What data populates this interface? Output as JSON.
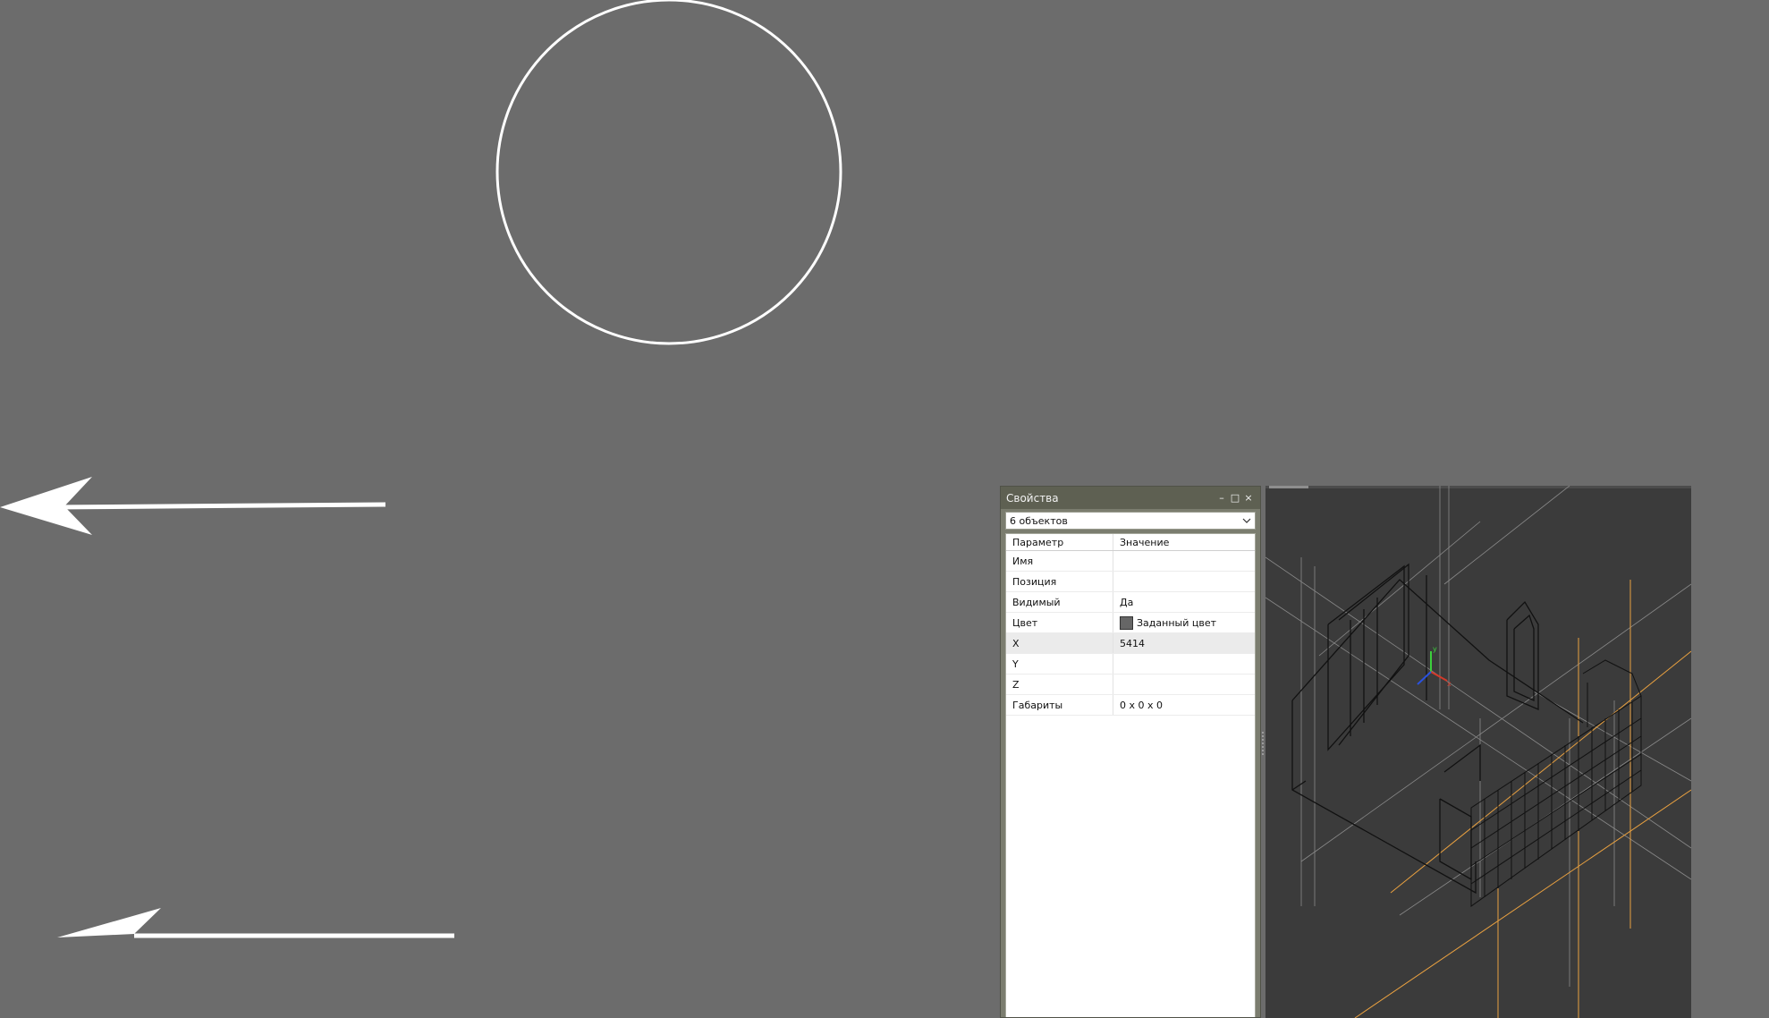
{
  "properties_panel": {
    "title": "Свойства",
    "controls": {
      "minimize": "–",
      "maximize": "□",
      "close": "×"
    },
    "selection": "6 объектов",
    "header": {
      "param": "Параметр",
      "value": "Значение"
    },
    "rows": [
      {
        "param": "Имя",
        "value": ""
      },
      {
        "param": "Позиция",
        "value": ""
      },
      {
        "param": "Видимый",
        "value": "Да"
      },
      {
        "param": "Цвет",
        "value": "Заданный цвет"
      },
      {
        "param": "X",
        "value": "5414"
      },
      {
        "param": "Y",
        "value": ""
      },
      {
        "param": "Z",
        "value": ""
      },
      {
        "param": "Габариты",
        "value": "0 x 0 x 0"
      }
    ]
  },
  "viewport": {
    "axis_labels": {
      "x": "x",
      "y": "y"
    },
    "colors": {
      "x": "#d23a2a",
      "y": "#3ccf3c",
      "z": "#2a52e0",
      "guide": "#e8a040"
    }
  },
  "colors": {
    "background": "#6c6c6c",
    "annotation": "#ffffff",
    "panel_title": "#5e6052",
    "viewport": "#3b3b3b"
  }
}
